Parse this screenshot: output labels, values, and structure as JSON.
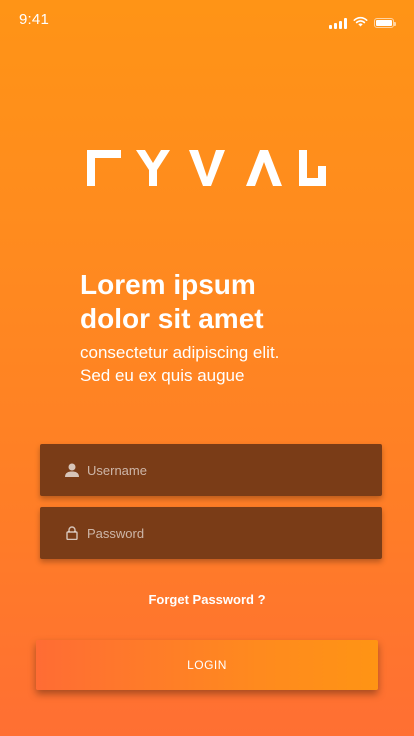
{
  "status_bar": {
    "time": "9:41",
    "icons": [
      "signal-icon",
      "wifi-icon",
      "battery-icon"
    ]
  },
  "brand": {
    "logo_text": "RYVAL",
    "logo_color": "#ffffff"
  },
  "hero": {
    "headline_line1": "Lorem ipsum",
    "headline_line2": "dolor sit amet",
    "subhead_line1": "consectetur adipiscing elit.",
    "subhead_line2": "Sed eu ex quis augue"
  },
  "form": {
    "username": {
      "placeholder": "Username",
      "value": "",
      "icon": "user-icon"
    },
    "password": {
      "placeholder": "Password",
      "value": "",
      "icon": "lock-icon"
    },
    "forgot_label": "Forget Password ?",
    "login_label": "LOGIN"
  },
  "colors": {
    "background_top": "#ff9416",
    "background_bottom": "#ff6f33",
    "field_bg": "#7a3c17",
    "text": "#ffffff"
  }
}
